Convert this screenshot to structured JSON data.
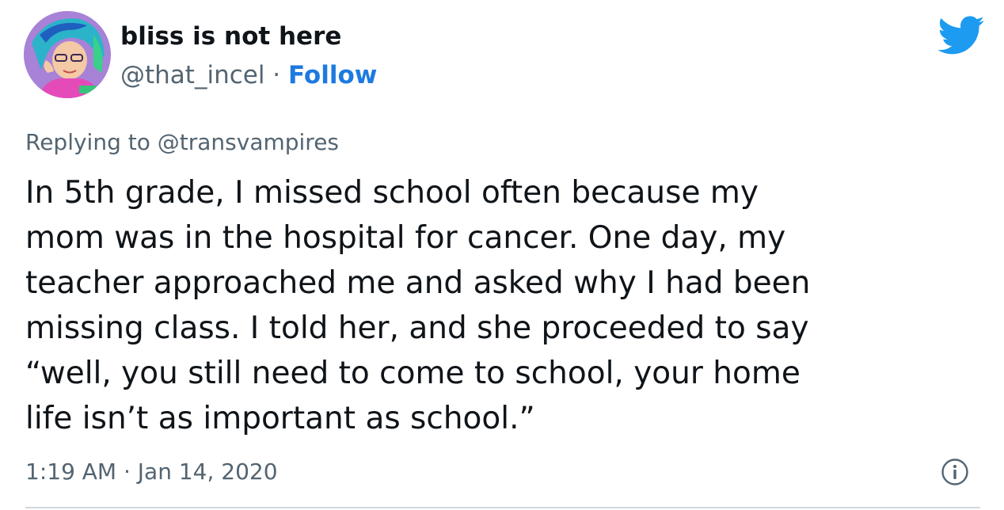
{
  "author": {
    "display_name": "bliss is not here",
    "handle": "@that_incel",
    "separator": " · ",
    "follow_label": "Follow"
  },
  "reply": {
    "prefix": "Replying to ",
    "target": "@transvampires"
  },
  "tweet": {
    "lines": [
      "In 5th grade, I missed school often because my",
      "mom was in the hospital for cancer. One day, my",
      "teacher approached me and asked why I had been",
      "missing class. I told her, and she proceeded to say",
      "“well, you still need to come to school, your home",
      "life isn’t as important as school.”"
    ],
    "time": "1:19 AM",
    "date_separator": " · ",
    "date": "Jan 14, 2020"
  },
  "icons": {
    "brand": "twitter-bird-icon",
    "info": "info-icon",
    "avatar": "avatar"
  },
  "colors": {
    "accent": "#1d9bf0",
    "follow": "#1d7ae0",
    "text": "#0f1419",
    "muted": "#536471",
    "divider": "#cfd9de"
  }
}
